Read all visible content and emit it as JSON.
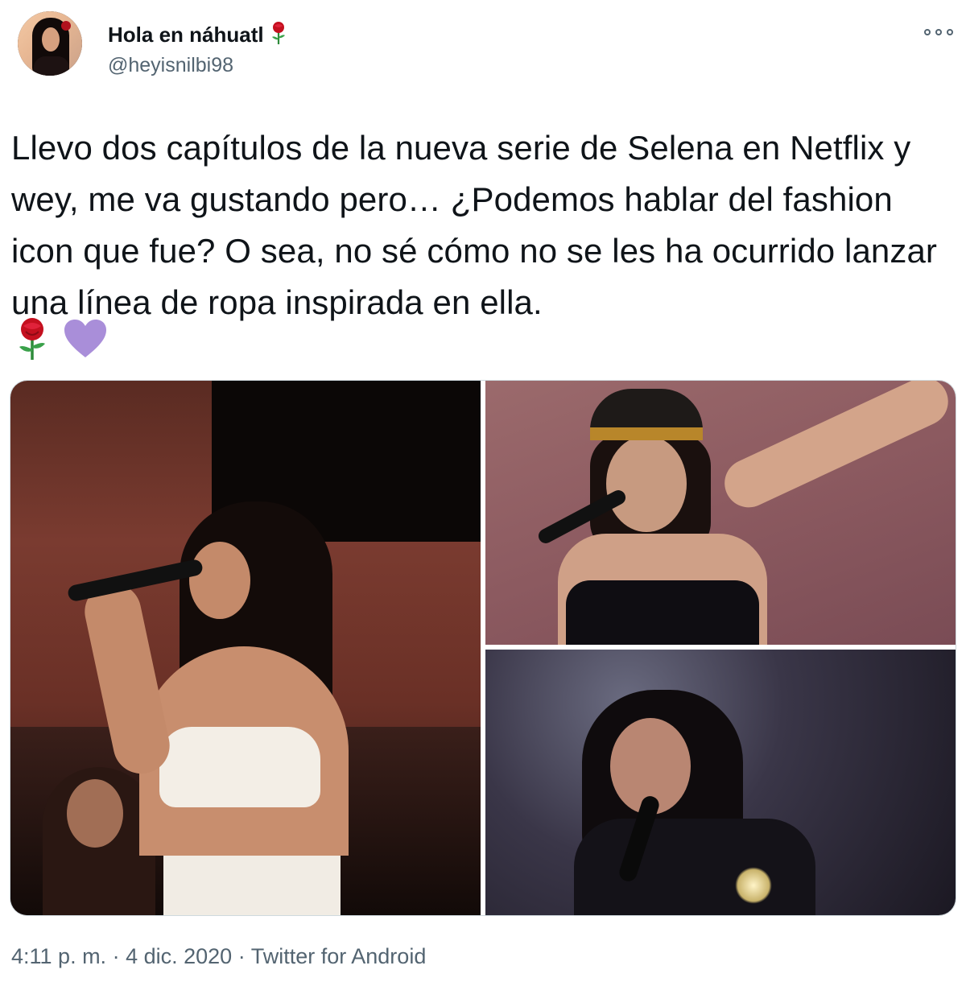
{
  "author": {
    "display_name": "Hola en náhuatl",
    "handle": "@heyisnilbi98",
    "name_emoji": "rose-icon"
  },
  "tweet": {
    "text": "Llevo dos capítulos de la nueva serie de Selena en Netflix y wey, me va gustando pero… ¿Podemos hablar del fashion icon que fue? O sea, no sé cómo no se les ha ocurrido lanzar una línea de ropa inspirada en ella.",
    "emojis": [
      "rose-icon",
      "purple-heart-icon"
    ]
  },
  "media": {
    "photos": [
      "selena-white-top-photo",
      "selena-cap-photo",
      "selena-leather-jacket-photo"
    ]
  },
  "meta": {
    "time": "4:11 p. m.",
    "date": "4 dic. 2020",
    "source": "Twitter for Android",
    "separator": "·"
  },
  "colors": {
    "text_primary": "#0f1419",
    "text_secondary": "#536471",
    "border": "#cfd9de",
    "rose_red": "#c4101f",
    "heart_purple": "#a98ed9"
  }
}
